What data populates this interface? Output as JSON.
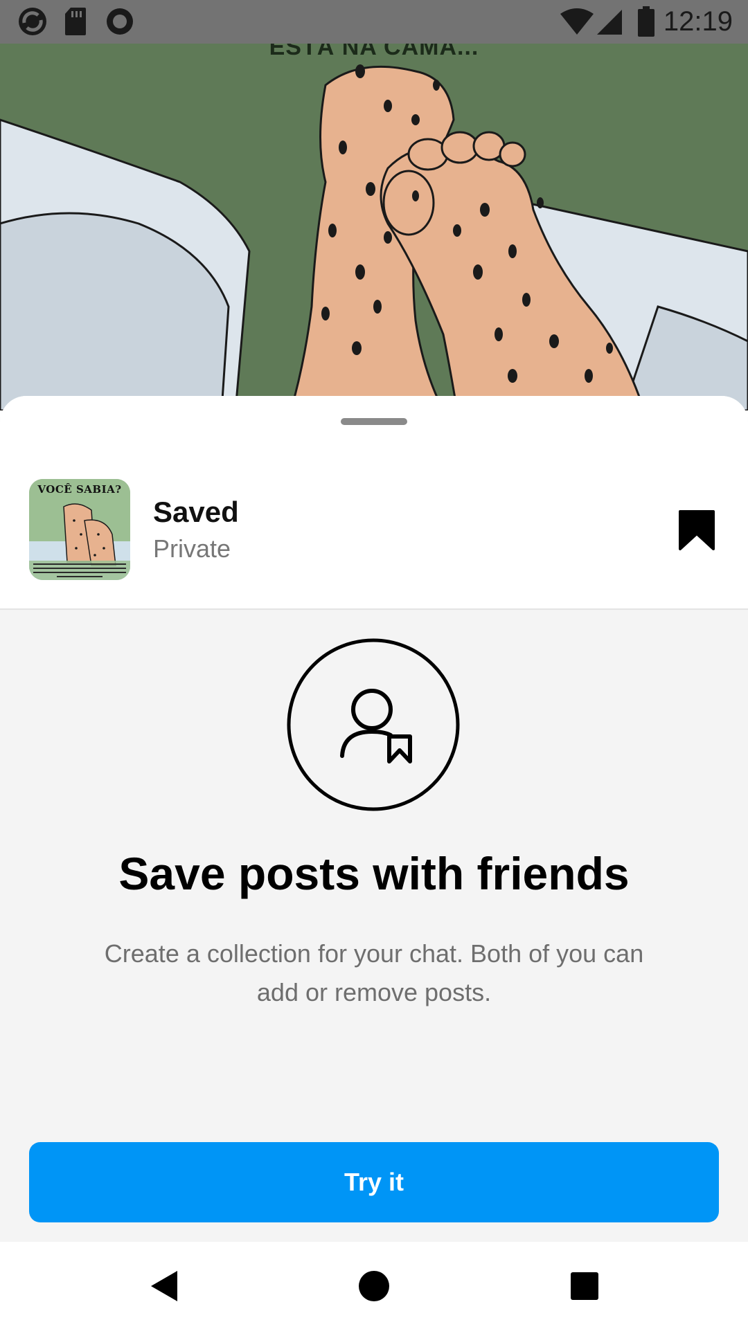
{
  "status_bar": {
    "time": "12:19",
    "left_icons": [
      "sync-icon",
      "sd-card-icon",
      "record-icon"
    ],
    "right_icons": [
      "wifi-icon",
      "signal-icon",
      "battery-icon"
    ]
  },
  "background_post": {
    "caption_fragment": "ESTÁ NA CAMA..."
  },
  "collection": {
    "thumbnail_title": "VOCÊ SABIA?",
    "name": "Saved",
    "privacy": "Private",
    "bookmark_icon": "bookmark-filled-icon"
  },
  "empty_state": {
    "icon": "person-bookmark-icon",
    "title": "Save posts with friends",
    "description": "Create a collection for your chat. Both of you can add or remove posts."
  },
  "primary_action": {
    "label": "Try it"
  },
  "colors": {
    "accent": "#0095f6",
    "status_bar": "#737373",
    "sheet_background": "#f4f4f4"
  },
  "nav_bar": {
    "buttons": [
      "back-icon",
      "home-icon",
      "recents-icon"
    ]
  }
}
